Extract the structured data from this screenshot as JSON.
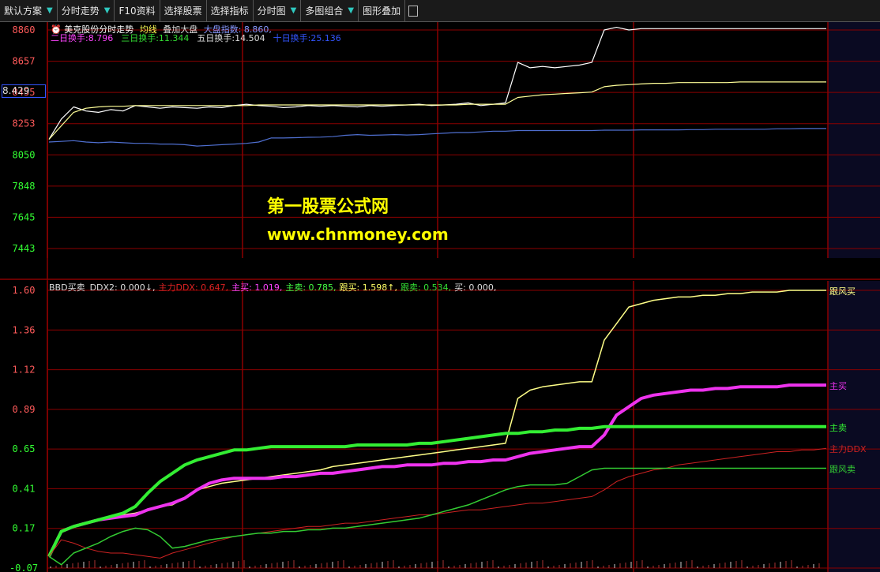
{
  "toolbar": {
    "items": [
      {
        "label": "默认方案",
        "has_arrow": true
      },
      {
        "label": "分时走势",
        "has_arrow": true
      },
      {
        "label": "F10资料",
        "has_arrow": false
      },
      {
        "label": "选择股票",
        "has_arrow": false
      },
      {
        "label": "选择指标",
        "has_arrow": false
      },
      {
        "label": "分时图",
        "has_arrow": true
      },
      {
        "label": "多图组合",
        "has_arrow": true
      },
      {
        "label": "图形叠加",
        "has_arrow": false
      }
    ]
  },
  "colors": {
    "bg": "#000000",
    "grid": "#8b0000",
    "axis_up": "#ff5a5a",
    "axis_down": "#33ff33"
  },
  "upper_panel": {
    "title": "美克股份分时走势",
    "avg_label": "均线",
    "overlay_label": "叠加大盘",
    "index_label": "大盘指数: 8.860,",
    "turnover": [
      {
        "text": "二日换手:8.796",
        "color": "#ff44ff"
      },
      {
        "text": "三日换手:11.344",
        "color": "#33dd33"
      },
      {
        "text": "五日换手:14.504",
        "color": "#dddddd"
      },
      {
        "text": "十日换手:25.136",
        "color": "#3355ff"
      }
    ],
    "current_value": "8.429",
    "chart_data": {
      "type": "line",
      "ylim": [
        7241,
        8860
      ],
      "y_ticks": [
        "8860",
        "8657",
        "8455",
        "8253",
        "8050",
        "7848",
        "7645",
        "7443"
      ],
      "series": [
        {
          "color": "#ffffff",
          "values": [
            8050,
            8200,
            8290,
            8260,
            8250,
            8270,
            8260,
            8300,
            8290,
            8280,
            8290,
            8285,
            8280,
            8290,
            8285,
            8300,
            8310,
            8300,
            8295,
            8285,
            8290,
            8300,
            8295,
            8300,
            8295,
            8290,
            8300,
            8295,
            8300,
            8305,
            8310,
            8300,
            8305,
            8310,
            8320,
            8300,
            8310,
            8320,
            8620,
            8580,
            8590,
            8580,
            8590,
            8600,
            8620,
            8860,
            8880,
            8860,
            8870,
            8870,
            8870,
            8870,
            8870,
            8870,
            8870,
            8870,
            8870,
            8870,
            8870,
            8870,
            8870,
            8870,
            8870,
            8870
          ]
        },
        {
          "color": "#ffff99",
          "values": [
            8050,
            8150,
            8250,
            8280,
            8290,
            8295,
            8295,
            8300,
            8300,
            8300,
            8300,
            8300,
            8300,
            8300,
            8300,
            8300,
            8300,
            8305,
            8305,
            8305,
            8305,
            8305,
            8305,
            8305,
            8305,
            8305,
            8305,
            8305,
            8305,
            8305,
            8305,
            8305,
            8305,
            8305,
            8310,
            8310,
            8310,
            8310,
            8360,
            8370,
            8380,
            8385,
            8390,
            8395,
            8400,
            8440,
            8450,
            8455,
            8460,
            8465,
            8465,
            8470,
            8470,
            8470,
            8470,
            8470,
            8475,
            8475,
            8475,
            8475,
            8475,
            8475,
            8475,
            8475
          ]
        },
        {
          "color": "#4f6fd0",
          "values": [
            8030,
            8035,
            8040,
            8030,
            8025,
            8030,
            8025,
            8020,
            8020,
            8015,
            8015,
            8010,
            8000,
            8005,
            8010,
            8015,
            8020,
            8030,
            8060,
            8060,
            8062,
            8065,
            8066,
            8070,
            8080,
            8085,
            8080,
            8082,
            8085,
            8082,
            8085,
            8090,
            8095,
            8100,
            8100,
            8105,
            8110,
            8110,
            8115,
            8115,
            8115,
            8115,
            8115,
            8115,
            8115,
            8118,
            8118,
            8118,
            8120,
            8120,
            8120,
            8120,
            8122,
            8122,
            8125,
            8125,
            8125,
            8125,
            8125,
            8128,
            8128,
            8130,
            8130,
            8130
          ]
        }
      ]
    }
  },
  "lower_panel": {
    "indicator_name": "BBD买卖",
    "readouts": [
      {
        "text": "DDX2: 0.000↓,",
        "color": "#dddddd"
      },
      {
        "text": "主力DDX: 0.647,",
        "color": "#dd2222"
      },
      {
        "text": "主买: 1.019,",
        "color": "#ff44ff"
      },
      {
        "text": "主卖: 0.785,",
        "color": "#44ff44"
      },
      {
        "text": "跟买: 1.598↑,",
        "color": "#ffff66"
      },
      {
        "text": "跟卖: 0.534,",
        "color": "#33dd33"
      },
      {
        "text": "买: 0.000,",
        "color": "#dddddd"
      }
    ],
    "chart_data": {
      "type": "line",
      "ylim": [
        -0.07,
        1.6
      ],
      "y_ticks": [
        "1.60",
        "1.36",
        "1.12",
        "0.89",
        "0.65",
        "0.41",
        "0.17",
        "-0.07"
      ],
      "series": [
        {
          "name": "跟风买",
          "color": "#ffff88",
          "width": 1.5,
          "values": [
            0.0,
            0.15,
            0.18,
            0.2,
            0.22,
            0.24,
            0.25,
            0.26,
            0.28,
            0.3,
            0.31,
            0.35,
            0.4,
            0.42,
            0.44,
            0.45,
            0.46,
            0.47,
            0.48,
            0.49,
            0.5,
            0.51,
            0.52,
            0.54,
            0.55,
            0.56,
            0.57,
            0.58,
            0.59,
            0.6,
            0.61,
            0.62,
            0.63,
            0.64,
            0.65,
            0.66,
            0.67,
            0.68,
            0.95,
            1.0,
            1.02,
            1.03,
            1.04,
            1.05,
            1.05,
            1.3,
            1.4,
            1.5,
            1.52,
            1.54,
            1.55,
            1.56,
            1.56,
            1.57,
            1.57,
            1.58,
            1.58,
            1.59,
            1.59,
            1.59,
            1.6,
            1.6,
            1.6,
            1.6
          ]
        },
        {
          "name": "主买",
          "color": "#ee33ee",
          "width": 4,
          "values": [
            0.0,
            0.15,
            0.18,
            0.2,
            0.22,
            0.23,
            0.24,
            0.25,
            0.28,
            0.3,
            0.32,
            0.35,
            0.4,
            0.44,
            0.46,
            0.47,
            0.47,
            0.47,
            0.47,
            0.48,
            0.48,
            0.49,
            0.5,
            0.5,
            0.51,
            0.52,
            0.53,
            0.54,
            0.54,
            0.55,
            0.55,
            0.55,
            0.56,
            0.56,
            0.57,
            0.57,
            0.58,
            0.58,
            0.6,
            0.62,
            0.63,
            0.64,
            0.65,
            0.66,
            0.66,
            0.73,
            0.85,
            0.9,
            0.95,
            0.97,
            0.98,
            0.99,
            1.0,
            1.0,
            1.01,
            1.01,
            1.02,
            1.02,
            1.02,
            1.02,
            1.03,
            1.03,
            1.03,
            1.03
          ]
        },
        {
          "name": "主卖",
          "color": "#33ee33",
          "width": 4,
          "values": [
            0.0,
            0.15,
            0.18,
            0.2,
            0.22,
            0.24,
            0.26,
            0.3,
            0.38,
            0.45,
            0.5,
            0.55,
            0.58,
            0.6,
            0.62,
            0.64,
            0.64,
            0.65,
            0.66,
            0.66,
            0.66,
            0.66,
            0.66,
            0.66,
            0.66,
            0.67,
            0.67,
            0.67,
            0.67,
            0.67,
            0.68,
            0.68,
            0.69,
            0.7,
            0.71,
            0.72,
            0.73,
            0.74,
            0.74,
            0.75,
            0.75,
            0.76,
            0.76,
            0.77,
            0.77,
            0.78,
            0.78,
            0.78,
            0.78,
            0.78,
            0.78,
            0.78,
            0.78,
            0.78,
            0.78,
            0.78,
            0.78,
            0.78,
            0.78,
            0.78,
            0.78,
            0.78,
            0.78,
            0.78
          ]
        },
        {
          "name": "主力DDX",
          "color": "#cc2222",
          "width": 1,
          "values": [
            0.0,
            0.1,
            0.08,
            0.05,
            0.03,
            0.02,
            0.02,
            0.01,
            0.0,
            -0.01,
            0.02,
            0.04,
            0.06,
            0.08,
            0.1,
            0.12,
            0.13,
            0.14,
            0.15,
            0.16,
            0.17,
            0.18,
            0.18,
            0.19,
            0.2,
            0.2,
            0.21,
            0.22,
            0.23,
            0.24,
            0.25,
            0.25,
            0.26,
            0.27,
            0.28,
            0.28,
            0.29,
            0.3,
            0.31,
            0.32,
            0.32,
            0.33,
            0.34,
            0.35,
            0.36,
            0.4,
            0.45,
            0.48,
            0.5,
            0.52,
            0.53,
            0.55,
            0.56,
            0.57,
            0.58,
            0.59,
            0.6,
            0.61,
            0.62,
            0.63,
            0.63,
            0.64,
            0.64,
            0.65
          ]
        },
        {
          "name": "跟风卖",
          "color": "#33cc33",
          "width": 1.5,
          "values": [
            0.0,
            -0.05,
            0.02,
            0.05,
            0.08,
            0.12,
            0.15,
            0.17,
            0.16,
            0.12,
            0.05,
            0.06,
            0.08,
            0.1,
            0.11,
            0.12,
            0.13,
            0.14,
            0.14,
            0.15,
            0.15,
            0.16,
            0.16,
            0.17,
            0.17,
            0.18,
            0.19,
            0.2,
            0.21,
            0.22,
            0.23,
            0.25,
            0.27,
            0.29,
            0.31,
            0.34,
            0.37,
            0.4,
            0.42,
            0.43,
            0.43,
            0.43,
            0.44,
            0.48,
            0.52,
            0.53,
            0.53,
            0.53,
            0.53,
            0.53,
            0.53,
            0.53,
            0.53,
            0.53,
            0.53,
            0.53,
            0.53,
            0.53,
            0.53,
            0.53,
            0.53,
            0.53,
            0.53,
            0.53
          ]
        }
      ]
    }
  },
  "watermark": {
    "line1": "第一股票公式网",
    "line2": "www.chnmoney.com"
  }
}
